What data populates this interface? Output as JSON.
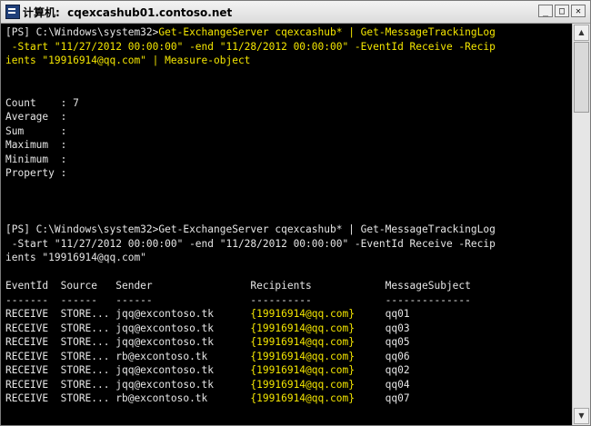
{
  "window": {
    "title": "计算机:  cqexcashub01.contoso.net"
  },
  "controls": {
    "minimize": "_",
    "maximize": "□",
    "close": "✕"
  },
  "console_lines": {
    "cmd1_prompt": "[PS] C:\\Windows\\system32>",
    "cmd1_part1": "Get-ExchangeServer cqexcashub* | Get-MessageTrackingLog",
    "cmd1_part2": " -Start \"11/27/2012 00:00:00\" -end \"11/28/2012 00:00:00\" -EventId Receive -Recip",
    "cmd1_part3": "ients \"19916914@qq.com\" | Measure-object",
    "count": "Count    : 7",
    "average": "Average  :",
    "sum": "Sum      :",
    "maximum": "Maximum  :",
    "minimum": "Minimum  :",
    "property": "Property :",
    "cmd2_line1": "[PS] C:\\Windows\\system32>Get-ExchangeServer cqexcashub* | Get-MessageTrackingLog",
    "cmd2_line2": " -Start \"11/27/2012 00:00:00\" -end \"11/28/2012 00:00:00\" -EventId Receive -Recip",
    "cmd2_line3": "ients \"19916914@qq.com\"",
    "header": "EventId  Source   Sender                Recipients            MessageSubject",
    "underline": "-------  ------   ------                ----------            --------------"
  },
  "table_rows": [
    {
      "lead": "RECEIVE  STORE... jqq@excontoso.tk      ",
      "recipients": "{19916914@qq.com}",
      "gap": "     ",
      "subject": "qq01"
    },
    {
      "lead": "RECEIVE  STORE... jqq@excontoso.tk      ",
      "recipients": "{19916914@qq.com}",
      "gap": "     ",
      "subject": "qq03"
    },
    {
      "lead": "RECEIVE  STORE... jqq@excontoso.tk      ",
      "recipients": "{19916914@qq.com}",
      "gap": "     ",
      "subject": "qq05"
    },
    {
      "lead": "RECEIVE  STORE... rb@excontoso.tk       ",
      "recipients": "{19916914@qq.com}",
      "gap": "     ",
      "subject": "qq06"
    },
    {
      "lead": "RECEIVE  STORE... jqq@excontoso.tk      ",
      "recipients": "{19916914@qq.com}",
      "gap": "     ",
      "subject": "qq02"
    },
    {
      "lead": "RECEIVE  STORE... jqq@excontoso.tk      ",
      "recipients": "{19916914@qq.com}",
      "gap": "     ",
      "subject": "qq04"
    },
    {
      "lead": "RECEIVE  STORE... rb@excontoso.tk       ",
      "recipients": "{19916914@qq.com}",
      "gap": "     ",
      "subject": "qq07"
    }
  ],
  "scrollbar": {
    "up": "▲",
    "down": "▼"
  },
  "colors": {
    "background": "#000000",
    "text": "#e6e6e6",
    "highlight": "#f4e600"
  }
}
